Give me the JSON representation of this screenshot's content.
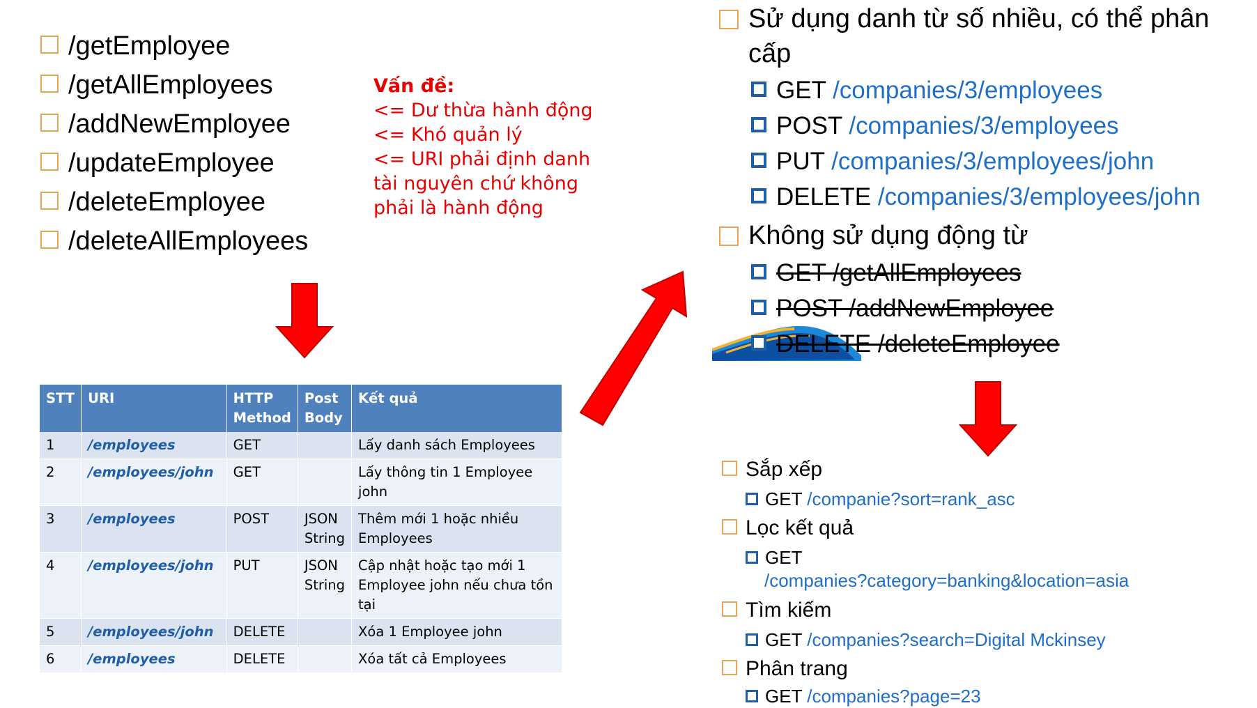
{
  "left_list": [
    "/getEmployee",
    "/getAllEmployees",
    "/addNewEmployee",
    "/updateEmployee",
    "/deleteEmployee",
    "/deleteAllEmployees"
  ],
  "problem": {
    "title": "Vấn đề:",
    "lines": [
      "<= Dư thừa hành động",
      "<= Khó quản lý",
      "<= URI phải định danh",
      "tài nguyên chứ không",
      "phải là hành động"
    ]
  },
  "table": {
    "headers": [
      "STT",
      "URI",
      "HTTP Method",
      "Post Body",
      "Kết quả"
    ],
    "rows": [
      {
        "stt": "1",
        "uri": "/employees",
        "method": "GET",
        "body": "",
        "result": "Lấy danh sách Employees"
      },
      {
        "stt": "2",
        "uri": "/employees/john",
        "method": "GET",
        "body": "",
        "result": "Lấy thông tin 1 Employee john"
      },
      {
        "stt": "3",
        "uri": "/employees",
        "method": "POST",
        "body": "JSON String",
        "result": "Thêm mới 1 hoặc nhiều Employees"
      },
      {
        "stt": "4",
        "uri": "/employees/john",
        "method": "PUT",
        "body": "JSON String",
        "result": "Cập nhật hoặc tạo mới 1 Employee john nếu chưa tồn tại"
      },
      {
        "stt": "5",
        "uri": "/employees/john",
        "method": "DELETE",
        "body": "",
        "result": "Xóa 1 Employee john"
      },
      {
        "stt": "6",
        "uri": "/employees",
        "method": "DELETE",
        "body": "",
        "result": "Xóa tất cả Employees"
      }
    ]
  },
  "right": {
    "plural_heading": "Sử dụng danh từ số nhiều, có thể phân cấp",
    "plural_items": [
      {
        "method": "GET",
        "uri": "/companies/3/employees"
      },
      {
        "method": "POST",
        "uri": "/companies/3/employees"
      },
      {
        "method": "PUT",
        "uri": "/companies/3/employees/john"
      },
      {
        "method": "DELETE",
        "uri": "/companies/3/employees/john"
      }
    ],
    "noverb_heading": "Không sử dụng động từ",
    "noverb_items": [
      "GET /getAllEmployees",
      "POST /addNewEmployee",
      "DELETE /deleteEmployee"
    ]
  },
  "bottom": {
    "sort_heading": "Sắp xếp",
    "sort_method": "GET",
    "sort_uri": "/companie?sort=rank_asc",
    "filter_heading": "Lọc kết quả",
    "filter_method": "GET",
    "filter_uri": "/companies?category=banking&location=asia",
    "search_heading": "Tìm kiếm",
    "search_method": "GET",
    "search_uri": "/companies?search=Digital Mckinsey",
    "page_heading": "Phân trang",
    "page_method": "GET",
    "page_uri": "/companies?page=23"
  },
  "colors": {
    "arrow": "#ff0000",
    "accent_blue": "#1f6fc8",
    "header_blue": "#4f81bd",
    "bullet_orange": "#e8a55a"
  }
}
